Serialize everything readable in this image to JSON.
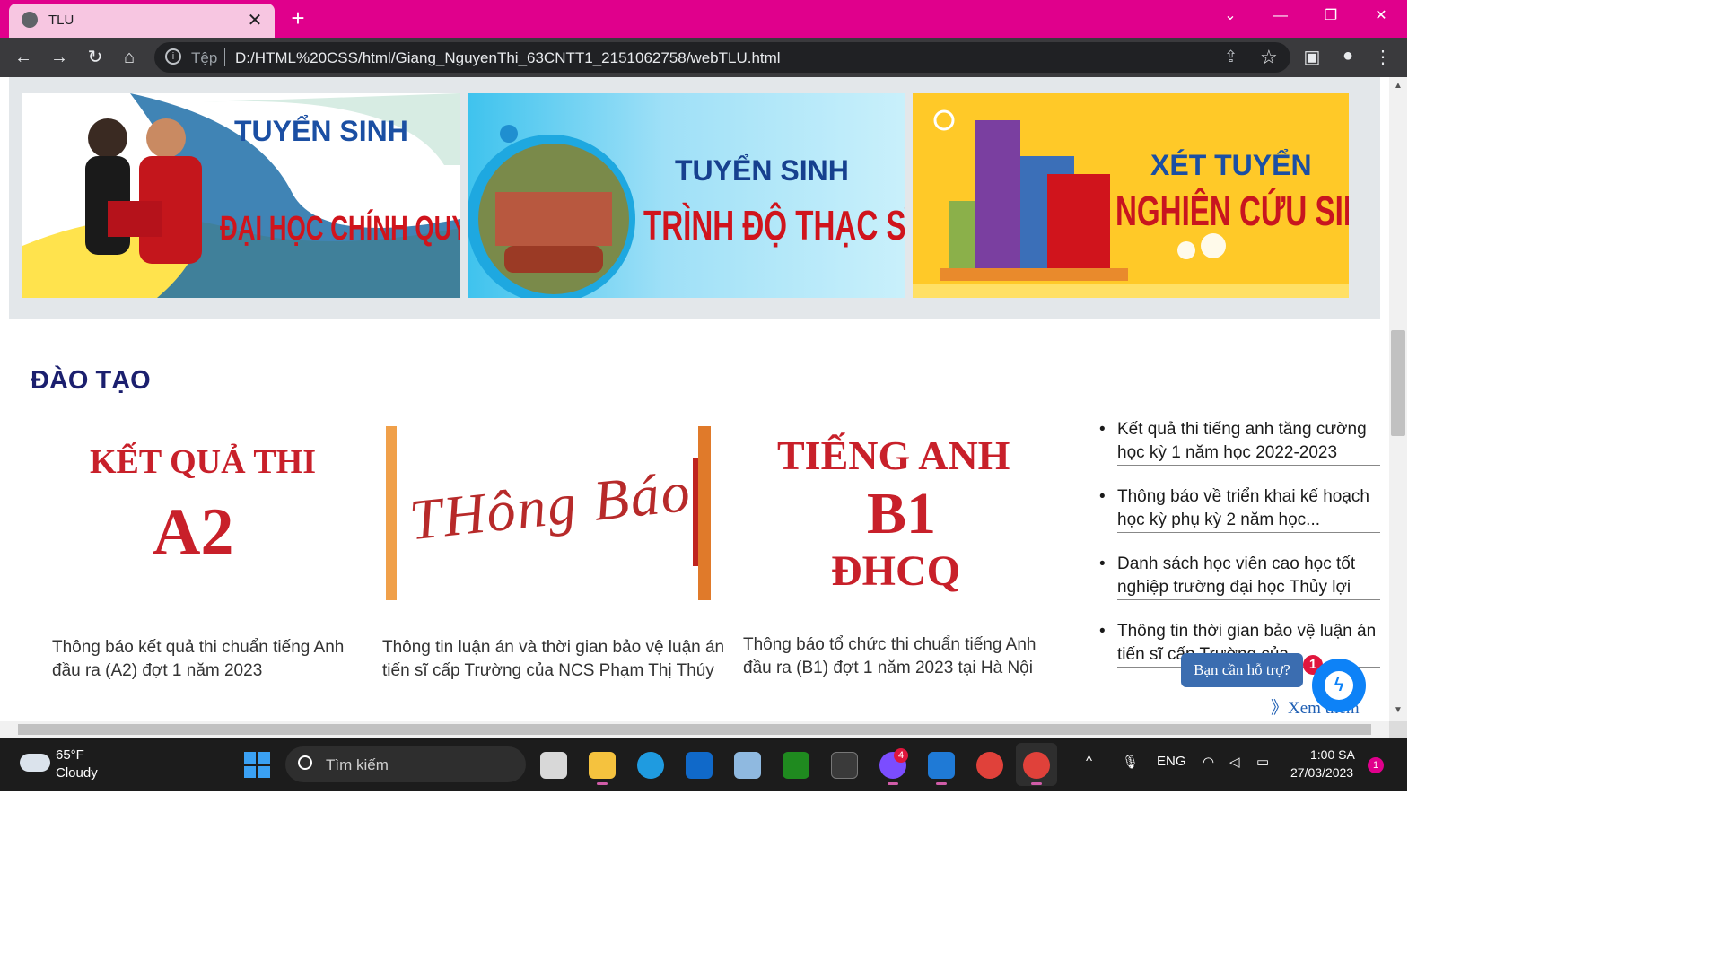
{
  "browser": {
    "tab_title": "TLU",
    "tab_close": "✕",
    "new_tab": "+",
    "address_scheme": "Tệp",
    "address_url": "D:/HTML%20CSS/html/Giang_NguyenThi_63CNTT1_2151062758/webTLU.html"
  },
  "banners": [
    {
      "line1": "TUYỂN SINH",
      "line2": "ĐẠI HỌC CHÍNH QUY"
    },
    {
      "line1": "TUYỂN SINH",
      "line2": "TRÌNH ĐỘ THẠC SĨ"
    },
    {
      "line1": "XÉT TUYỂN",
      "line2": "NGHIÊN CỨU SINH"
    }
  ],
  "section_title": "ĐÀO TẠO",
  "cards": [
    {
      "thumb_line1": "KẾT QUẢ THI",
      "thumb_line2": "A2",
      "caption": "Thông báo kết quả thi chuẩn tiếng Anh đầu ra (A2) đợt 1 năm 2023"
    },
    {
      "thumb_line1": "THông Báo",
      "caption": "Thông tin luận án và thời gian bảo vệ luận án tiến sĩ cấp Trường của NCS Phạm Thị Thúy"
    },
    {
      "thumb_line1": "TIẾNG ANH",
      "thumb_line2": "B1",
      "thumb_line3": "ĐHCQ",
      "caption": "Thông báo tổ chức thi chuẩn tiếng Anh đầu ra (B1) đợt 1 năm 2023 tại Hà Nội"
    }
  ],
  "news": [
    "Kết quả thi tiếng anh tăng cường học kỳ 1 năm học 2022-2023",
    "Thông báo về triển khai kế hoạch học kỳ phụ kỳ 2 năm học...",
    "Danh sách học viên cao học tốt nghiệp trường đại học Thủy lợi",
    "Thông tin thời gian bảo vệ luận án tiến sĩ cấp Trường của..."
  ],
  "see_more": "》Xem thêm",
  "chat": {
    "help_text": "Bạn cần hỗ trợ?",
    "badge": "1"
  },
  "taskbar": {
    "weather_temp": "65°F",
    "weather_desc": "Cloudy",
    "search_text": "Tìm kiếm",
    "messenger_badge": "4",
    "lang": "ENG",
    "time": "1:00 SA",
    "date": "27/03/2023",
    "notifications": "1"
  },
  "colors": {
    "tabbar": "#e0008c",
    "section_title": "#1b1f6e",
    "accent_red": "#c8202a"
  }
}
